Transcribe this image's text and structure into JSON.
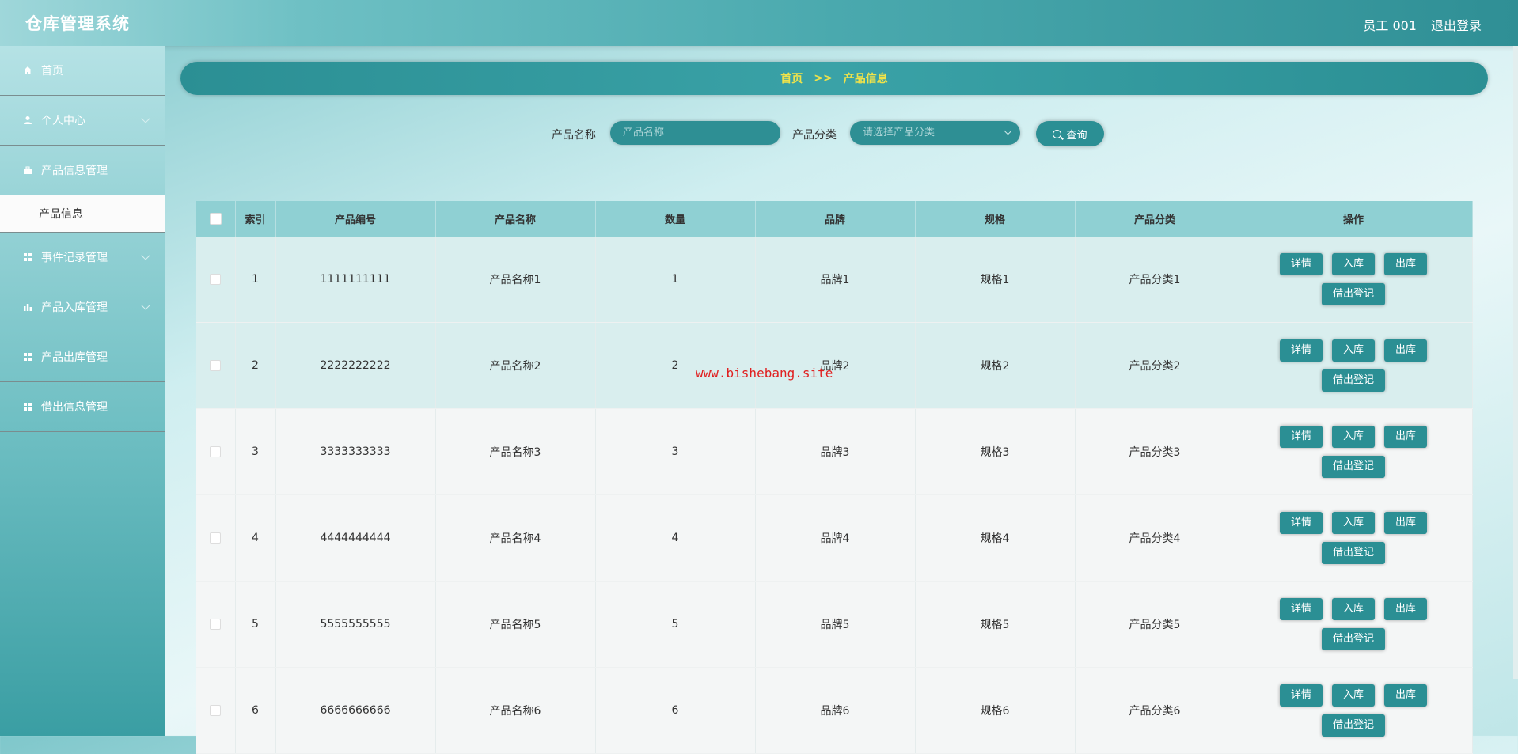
{
  "header": {
    "title": "仓库管理系统",
    "user": "员工 001",
    "logout": "退出登录"
  },
  "sidebar": {
    "items": [
      {
        "label": "首页",
        "icon": "home-icon",
        "has_arrow": false
      },
      {
        "label": "个人中心",
        "icon": "user-icon",
        "has_arrow": true
      },
      {
        "label": "产品信息管理",
        "icon": "briefcase-icon",
        "has_arrow": false,
        "expanded": true
      },
      {
        "label": "事件记录管理",
        "icon": "grid-icon",
        "has_arrow": true
      },
      {
        "label": "产品入库管理",
        "icon": "bar-chart-icon",
        "has_arrow": true
      },
      {
        "label": "产品出库管理",
        "icon": "grid-icon",
        "has_arrow": false
      },
      {
        "label": "借出信息管理",
        "icon": "grid-icon",
        "has_arrow": false
      }
    ],
    "submenu": {
      "label": "产品信息"
    }
  },
  "breadcrumb": {
    "home": "首页",
    "separator": ">>",
    "current": "产品信息"
  },
  "search": {
    "name_label": "产品名称",
    "name_placeholder": "产品名称",
    "category_label": "产品分类",
    "category_placeholder": "请选择产品分类",
    "query_button": "查询"
  },
  "table": {
    "columns": [
      "索引",
      "产品编号",
      "产品名称",
      "数量",
      "品牌",
      "规格",
      "产品分类",
      "操作"
    ],
    "actions": [
      "详情",
      "入库",
      "出库",
      "借出登记"
    ],
    "rows": [
      {
        "index": "1",
        "code": "1111111111",
        "name": "产品名称1",
        "qty": "1",
        "brand": "品牌1",
        "spec": "规格1",
        "category": "产品分类1"
      },
      {
        "index": "2",
        "code": "2222222222",
        "name": "产品名称2",
        "qty": "2",
        "brand": "品牌2",
        "spec": "规格2",
        "category": "产品分类2"
      },
      {
        "index": "3",
        "code": "3333333333",
        "name": "产品名称3",
        "qty": "3",
        "brand": "品牌3",
        "spec": "规格3",
        "category": "产品分类3"
      },
      {
        "index": "4",
        "code": "4444444444",
        "name": "产品名称4",
        "qty": "4",
        "brand": "品牌4",
        "spec": "规格4",
        "category": "产品分类4"
      },
      {
        "index": "5",
        "code": "5555555555",
        "name": "产品名称5",
        "qty": "5",
        "brand": "品牌5",
        "spec": "规格5",
        "category": "产品分类5"
      },
      {
        "index": "6",
        "code": "6666666666",
        "name": "产品名称6",
        "qty": "6",
        "brand": "品牌6",
        "spec": "规格6",
        "category": "产品分类6"
      }
    ]
  },
  "watermark": "www.bishebang.site",
  "colors": {
    "accent": "#2b8f94",
    "header_bg": "#4aa9ae",
    "breadcrumb_text": "#f0e34a",
    "table_header": "#8fd0d3"
  }
}
